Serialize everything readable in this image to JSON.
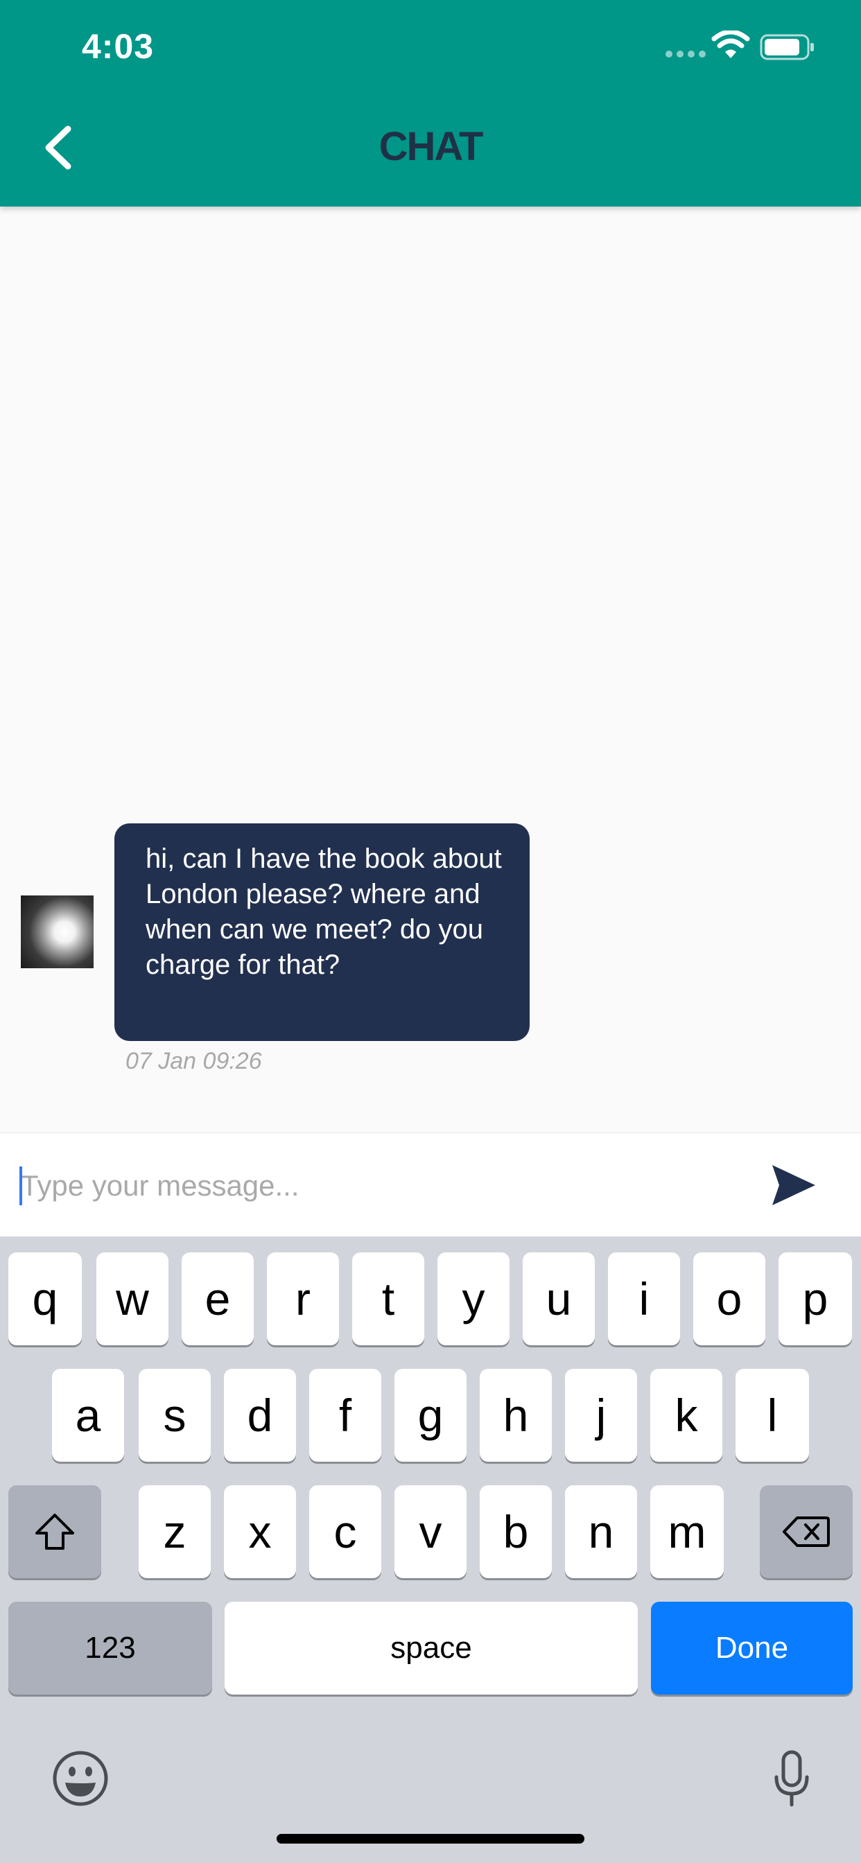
{
  "status_bar": {
    "time": "4:03"
  },
  "header": {
    "title": "CHAT"
  },
  "messages": [
    {
      "text": "hi, can I have the book about London please? where and when can we meet? do you charge for that?",
      "timestamp": "07 Jan 09:26"
    }
  ],
  "composer": {
    "placeholder": "Type your message...",
    "value": ""
  },
  "keyboard": {
    "row1": [
      "q",
      "w",
      "e",
      "r",
      "t",
      "y",
      "u",
      "i",
      "o",
      "p"
    ],
    "row2": [
      "a",
      "s",
      "d",
      "f",
      "g",
      "h",
      "j",
      "k",
      "l"
    ],
    "row3": [
      "z",
      "x",
      "c",
      "v",
      "b",
      "n",
      "m"
    ],
    "numbers_label": "123",
    "space_label": "space",
    "done_label": "Done"
  },
  "colors": {
    "header_bg": "#009688",
    "bubble_bg": "#22304f",
    "done_key": "#0a7cff"
  },
  "icons": [
    "back-icon",
    "wifi-icon",
    "battery-icon",
    "send-icon",
    "shift-icon",
    "backspace-icon",
    "emoji-icon",
    "mic-icon"
  ]
}
